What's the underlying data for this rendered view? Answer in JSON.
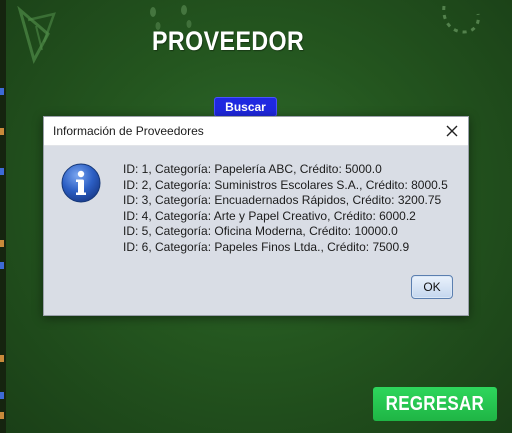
{
  "app": {
    "title": "PROVEEDOR",
    "search_label": "Buscar",
    "return_label": "REGRESAR"
  },
  "dialog": {
    "title": "Información de Proveedores",
    "icon": "info-icon",
    "lines": [
      "ID: 1, Categoría: Papelería ABC, Crédito: 5000.0",
      "ID: 2, Categoría: Suministros Escolares S.A., Crédito: 8000.5",
      "ID: 3, Categoría: Encuadernados Rápidos, Crédito: 3200.75",
      "ID: 4, Categoría: Arte y Papel Creativo, Crédito: 6000.2",
      "ID: 5, Categoría: Oficina Moderna, Crédito: 10000.0",
      "ID: 6, Categoría: Papeles Finos Ltda., Crédito: 7500.9"
    ],
    "ok_label": "OK"
  },
  "colors": {
    "background": "#24561f",
    "search_button": "#1f28e0",
    "return_button": "#1fb545",
    "dialog_body": "#d9dde5"
  }
}
